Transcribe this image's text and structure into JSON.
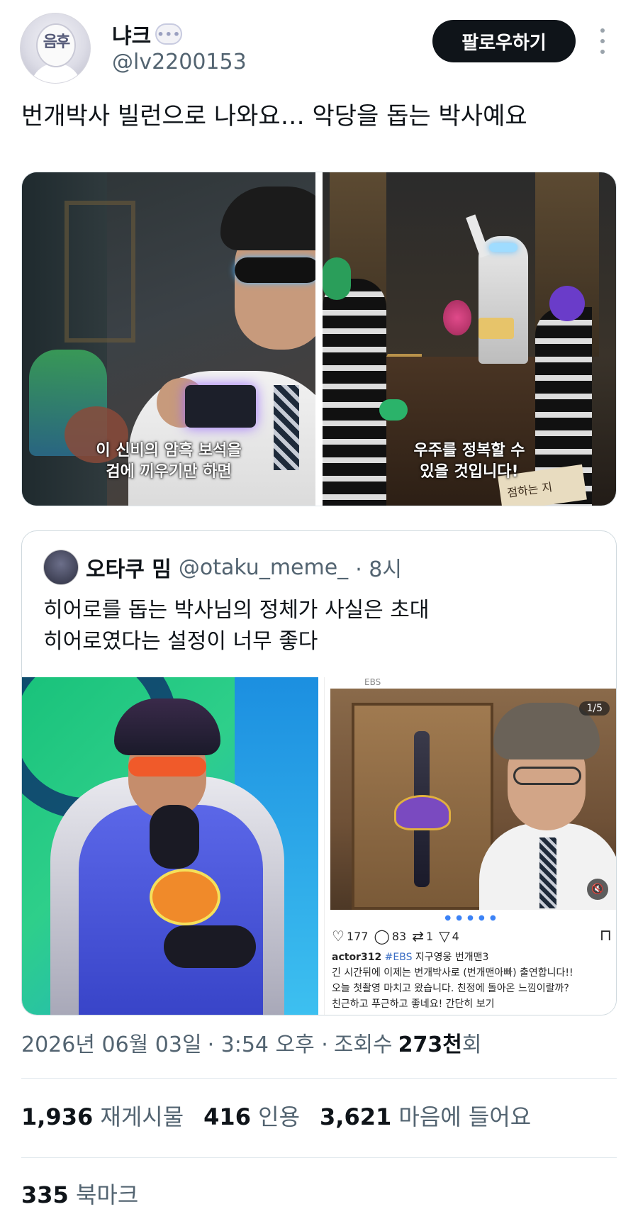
{
  "author": {
    "display_name": "냐크",
    "handle": "@lv2200153",
    "avatar_text": "음후",
    "badge_icon": "speech-bubble-icon"
  },
  "follow_label": "팔로우하기",
  "more_icon": "more-vertical-icon",
  "tweet_text": "번개박사 빌런으로 나와요… 악당을 돕는 박사예요",
  "media": [
    {
      "subtitle_line1": "이 신비의 암흑 보석을",
      "subtitle_line2": "검에 끼우기만 하면"
    },
    {
      "subtitle_line1": "우주를 정복할 수",
      "subtitle_line2": "있을 것입니다!",
      "sign_text": "점하는 지"
    }
  ],
  "quote": {
    "display_name": "오타쿠 밈",
    "handle": "@otaku_meme_",
    "time": "· 8시",
    "text_line1": "히어로를 돕는 박사님의 정체가 사실은 초대",
    "text_line2": "히어로였다는 설정이 너무 좋다",
    "insta": {
      "top_label": "EBS",
      "counter": "1/5",
      "likes": "177",
      "comments": "83",
      "reposts": "1",
      "shares": "4",
      "caption_user": "actor312",
      "caption_tag": "#EBS",
      "caption_line1": "지구영웅 번개맨3",
      "caption_line2": "긴 시간뒤에 이제는 번개박사로 (번개맨아빠) 출연합니다!!",
      "caption_line3": "오늘 첫촬영 마치고 왔습니다. 친정에 돌아온 느낌이랄까?",
      "caption_line4": "친근하고 푸근하고 좋네요! 간단히 보기"
    }
  },
  "timestamp": {
    "date": "2026년 06월 03일",
    "time": "· 3:54 오후 ·",
    "views_label": "조회수",
    "views_value": "273천",
    "views_suffix": "회"
  },
  "stats": {
    "reposts_value": "1,936",
    "reposts_label": "재게시물",
    "quotes_value": "416",
    "quotes_label": "인용",
    "likes_value": "3,621",
    "likes_label": "마음에 들어요",
    "bookmarks_value": "335",
    "bookmarks_label": "북마크"
  }
}
